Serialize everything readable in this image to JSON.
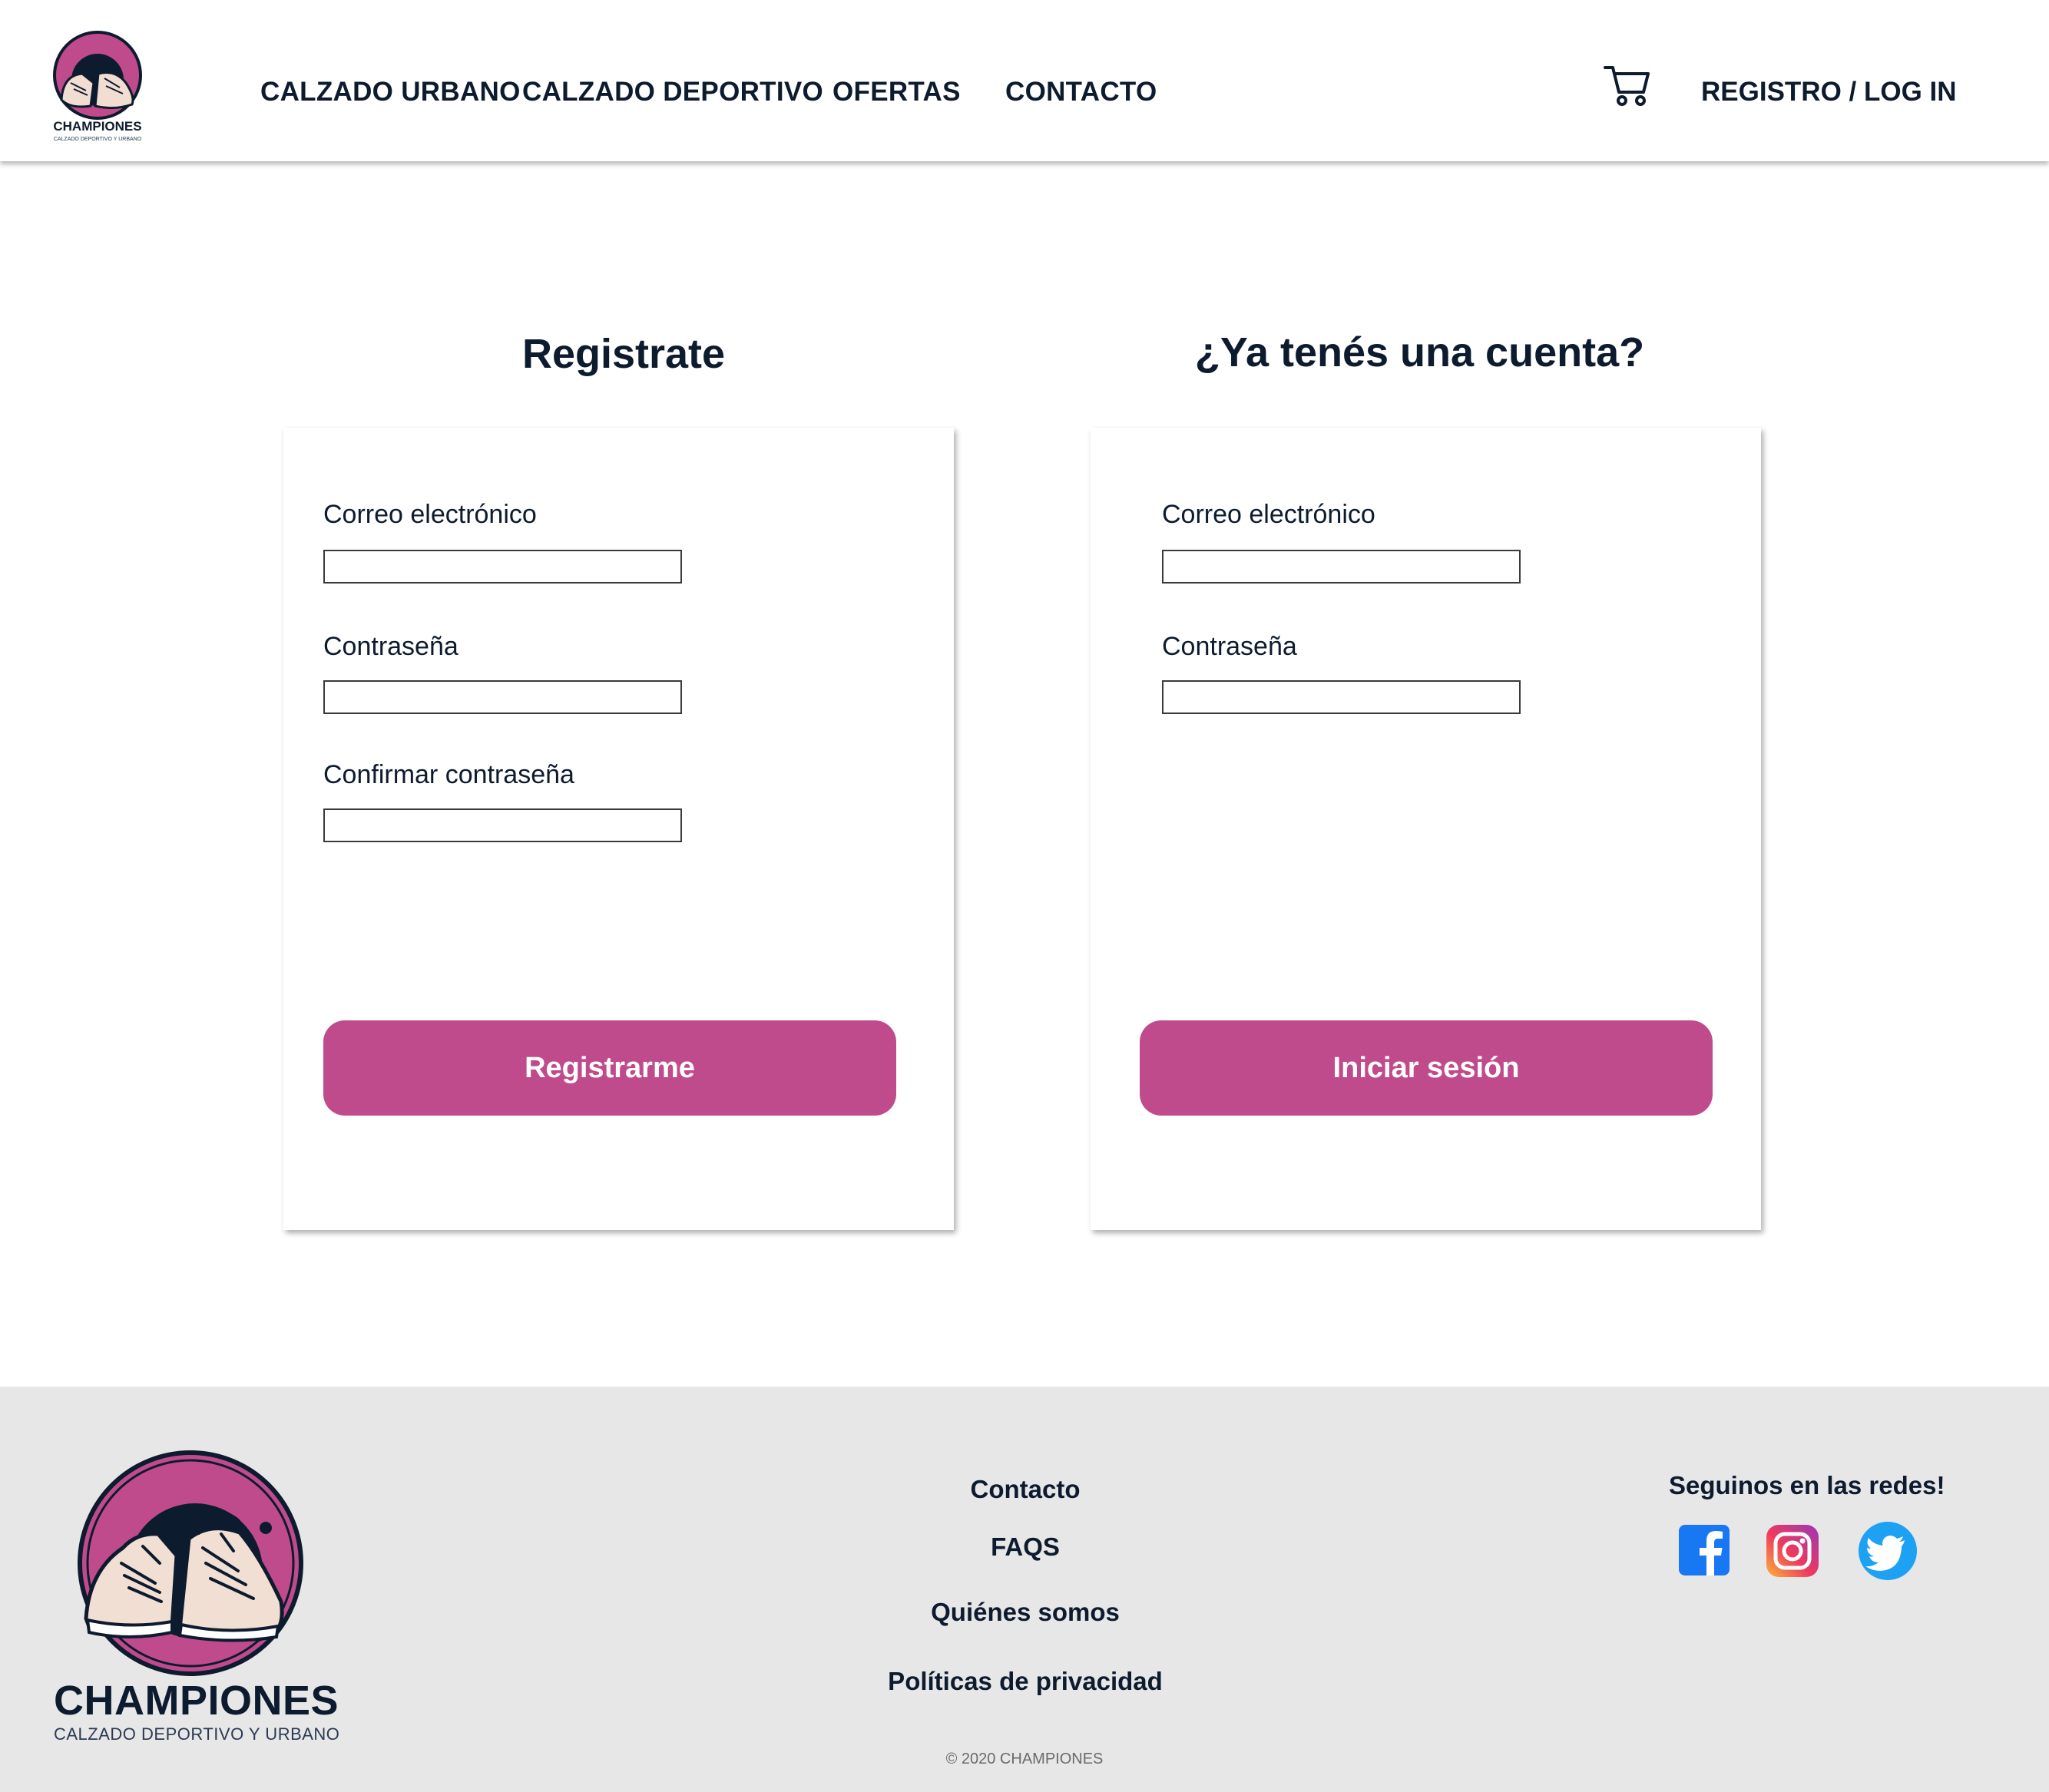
{
  "header": {
    "logo_text": "CHAMPIONES",
    "logo_tagline": "CALZADO DEPORTIVO Y URBANO",
    "nav": [
      {
        "label": "CALZADO URBANO"
      },
      {
        "label": "CALZADO DEPORTIVO"
      },
      {
        "label": "OFERTAS"
      },
      {
        "label": "CONTACTO"
      }
    ],
    "cart_icon": "shopping-cart-icon",
    "login_label": "REGISTRO / LOG IN"
  },
  "register": {
    "title": "Registrate",
    "email_label": "Correo electrónico",
    "email_value": "",
    "password_label": "Contraseña",
    "password_value": "",
    "confirm_label": "Confirmar contraseña",
    "confirm_value": "",
    "button_label": "Registrarme"
  },
  "login": {
    "title": "¿Ya tenés una cuenta?",
    "email_label": "Correo electrónico",
    "email_value": "",
    "password_label": "Contraseña",
    "password_value": "",
    "button_label": "Iniciar sesión"
  },
  "footer": {
    "brand_name": "CHAMPIONES",
    "brand_tagline": "CALZADO DEPORTIVO Y URBANO",
    "links": [
      {
        "label": "Contacto"
      },
      {
        "label": "FAQS"
      },
      {
        "label": "Quiénes somos"
      },
      {
        "label": "Políticas de privacidad"
      }
    ],
    "social_title": "Seguinos en las redes!",
    "social": [
      {
        "icon": "facebook-icon",
        "color": "#1877f2"
      },
      {
        "icon": "instagram-icon",
        "color": "#d6249f"
      },
      {
        "icon": "twitter-icon",
        "color": "#1da1f2"
      }
    ],
    "copyright": "© 2020 CHAMPIONES"
  },
  "colors": {
    "accent": "#c04b8c",
    "text": "#0d1b2e",
    "footer_bg": "#e7e7e8"
  }
}
